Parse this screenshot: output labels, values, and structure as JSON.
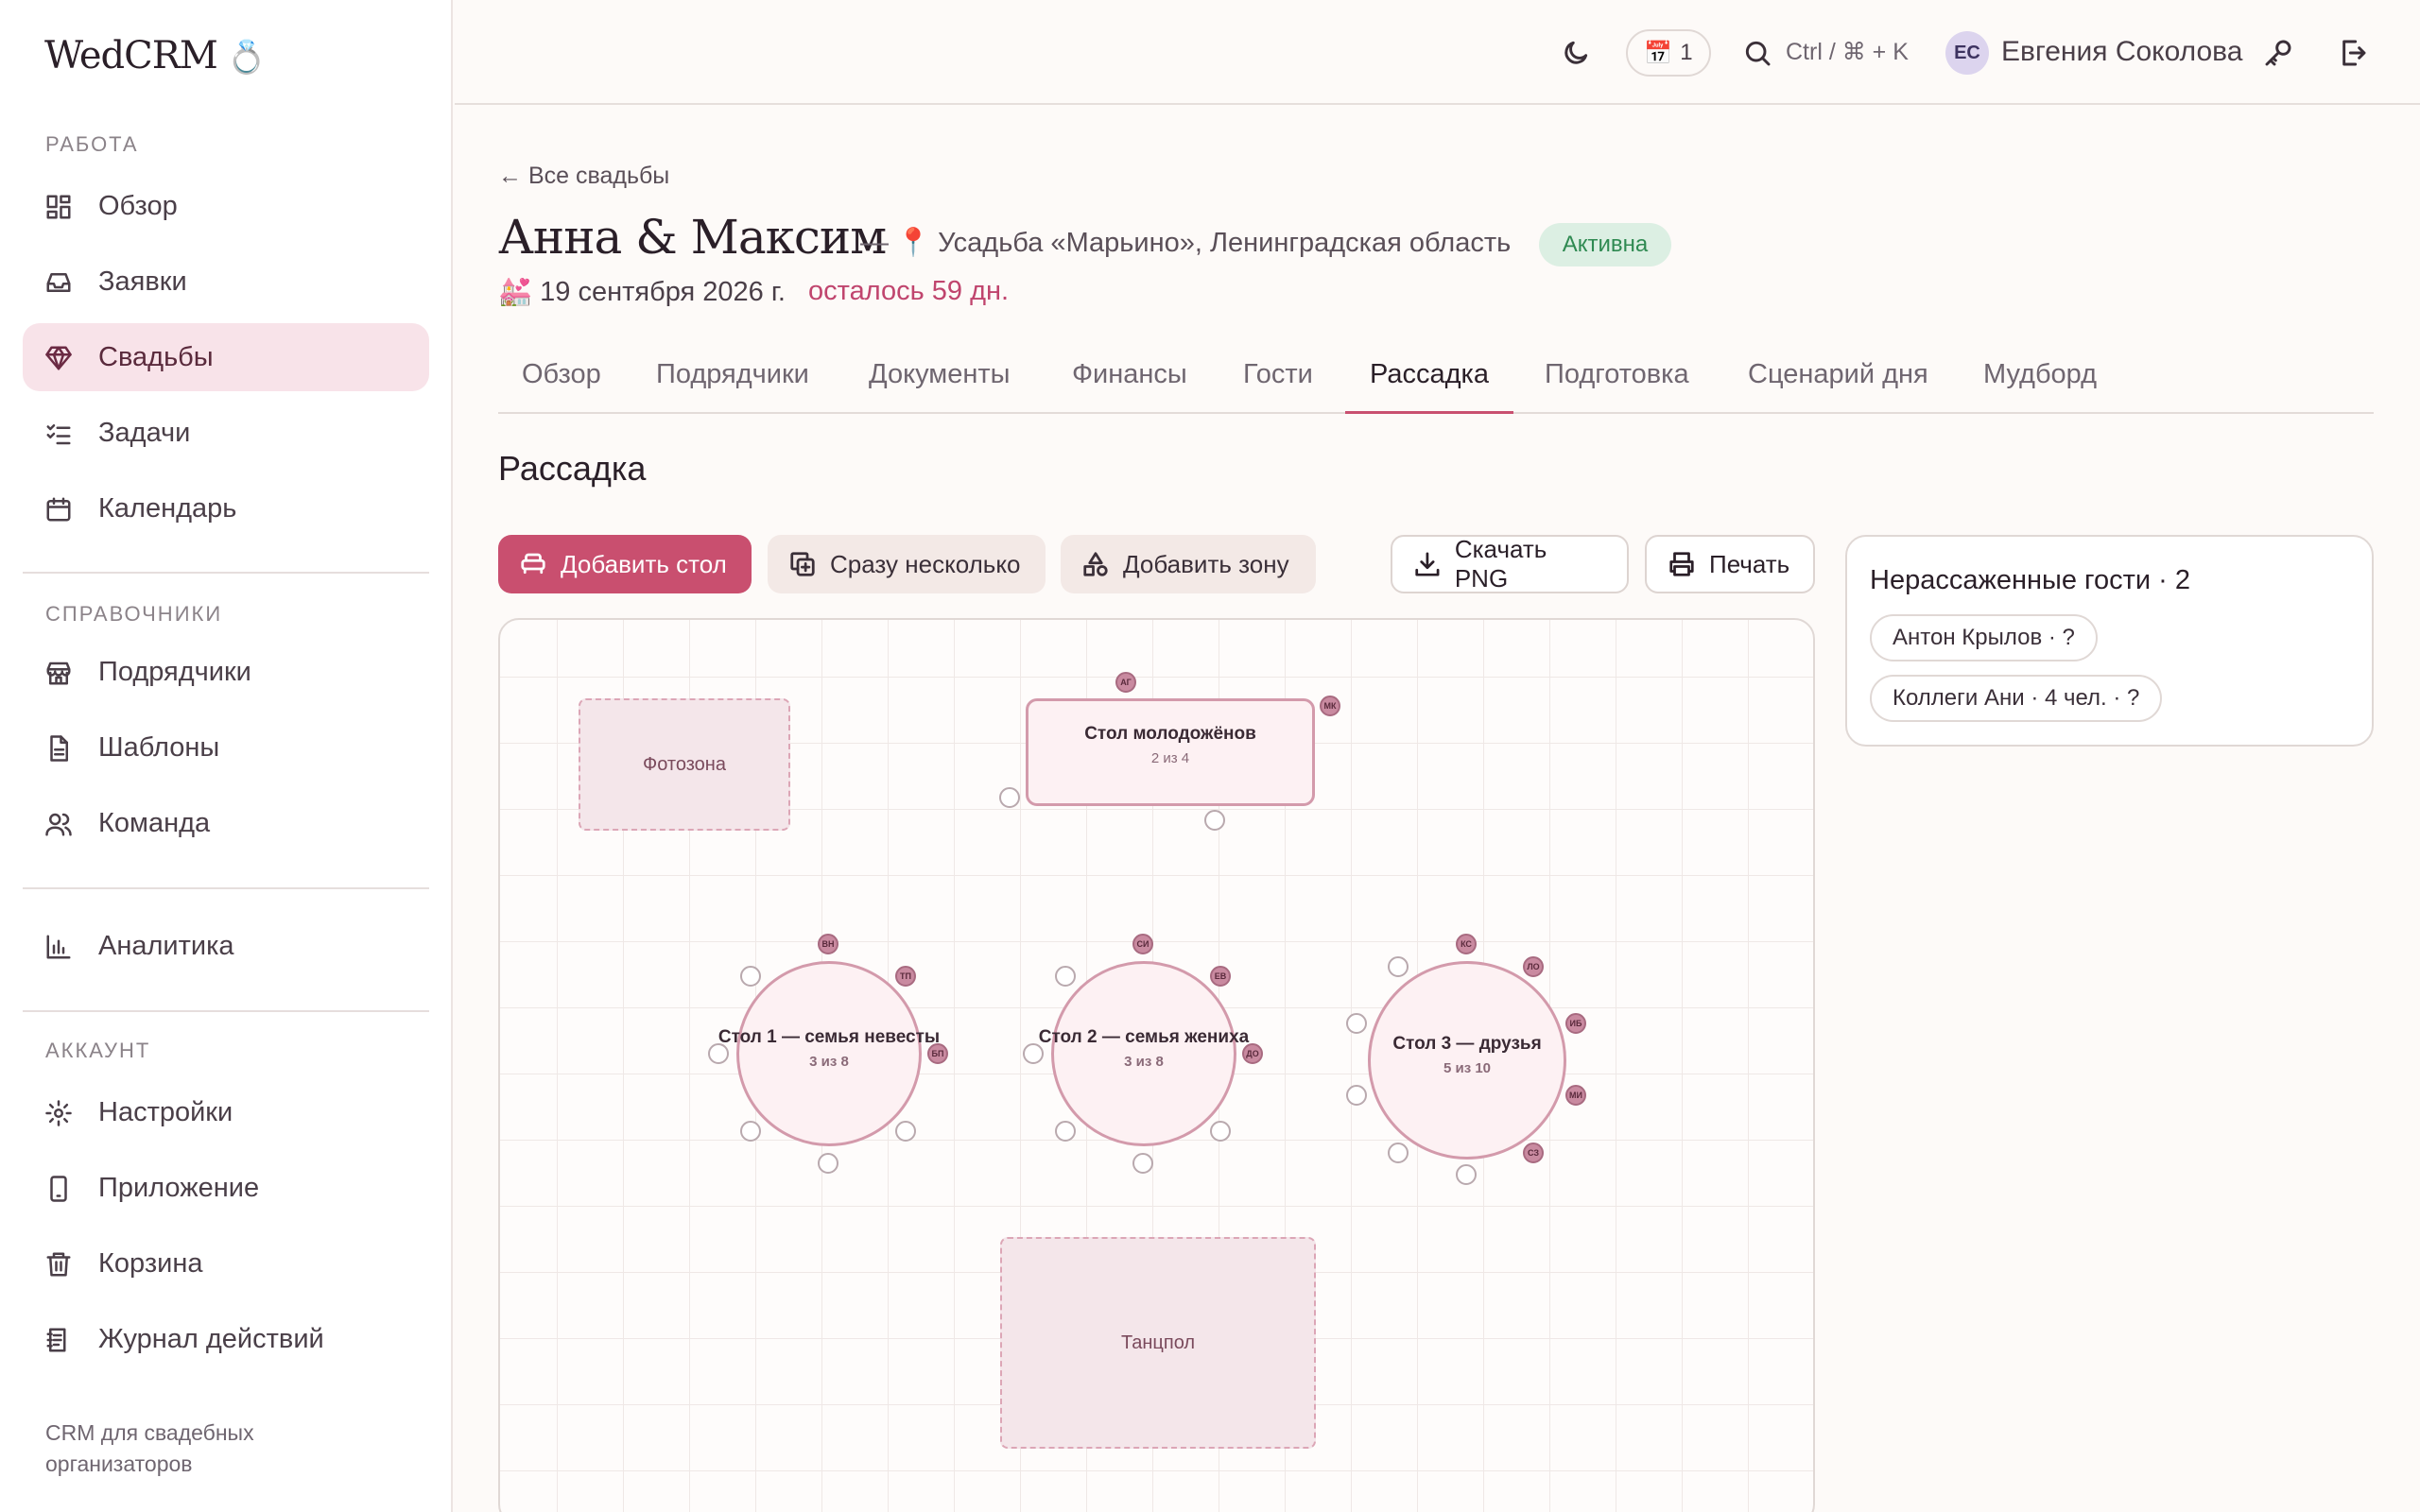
{
  "app": {
    "name": "WedCRM"
  },
  "sidebar": {
    "sections": {
      "work": "РАБОТА",
      "refs": "СПРАВОЧНИКИ",
      "account": "АККАУНТ"
    },
    "items": [
      {
        "label": "Обзор",
        "icon": "dashboard-icon"
      },
      {
        "label": "Заявки",
        "icon": "inbox-icon"
      },
      {
        "label": "Свадьбы",
        "icon": "diamond-icon"
      },
      {
        "label": "Задачи",
        "icon": "checklist-icon"
      },
      {
        "label": "Календарь",
        "icon": "calendar-icon"
      },
      {
        "label": "Подрядчики",
        "icon": "store-icon"
      },
      {
        "label": "Шаблоны",
        "icon": "document-icon"
      },
      {
        "label": "Команда",
        "icon": "users-icon"
      },
      {
        "label": "Аналитика",
        "icon": "chart-icon"
      },
      {
        "label": "Настройки",
        "icon": "gear-icon"
      },
      {
        "label": "Приложение",
        "icon": "phone-icon"
      },
      {
        "label": "Корзина",
        "icon": "trash-icon"
      },
      {
        "label": "Журнал действий",
        "icon": "log-icon"
      }
    ],
    "active": "Свадьбы",
    "footer": "CRM для свадебных организаторов"
  },
  "topbar": {
    "notifications_count": "1",
    "search_shortcut": "Ctrl / ⌘ + K",
    "user_initials": "ЕС",
    "user_name": "Евгения Соколова"
  },
  "page": {
    "back_link": "← Все свадьбы",
    "title": "Анна & Максим",
    "dash": "—",
    "venue": "📍 Усадьба «Марьино», Ленинградская область",
    "status": "Активна",
    "date": "💒 19 сентября 2026 г.",
    "remaining": "осталось 59 дн."
  },
  "tabs": [
    "Обзор",
    "Подрядчики",
    "Документы",
    "Финансы",
    "Гости",
    "Рассадка",
    "Подготовка",
    "Сценарий дня",
    "Мудборд"
  ],
  "active_tab": "Рассадка",
  "section_title": "Рассадка",
  "toolbar": {
    "add_table": "Добавить стол",
    "add_many": "Сразу несколько",
    "add_zone": "Добавить зону",
    "download_png": "Скачать PNG",
    "print": "Печать"
  },
  "plan": {
    "zones": {
      "photo": "Фотозона",
      "dance": "Танцпол"
    },
    "newlyweds": {
      "name": "Стол молодожёнов",
      "count": "2 из 4",
      "seats": [
        "АГ",
        "МК"
      ]
    },
    "table1": {
      "name": "Стол 1 — семья невесты",
      "count": "3 из 8",
      "seats": [
        "ВН",
        "ТП",
        "БП"
      ]
    },
    "table2": {
      "name": "Стол 2 — семья жениха",
      "count": "3 из 8",
      "seats": [
        "СИ",
        "ЕВ",
        "ДО"
      ]
    },
    "table3": {
      "name": "Стол 3 — друзья",
      "count": "5 из 10",
      "seats": [
        "КС",
        "ЛО",
        "ИБ",
        "МИ",
        "СЗ"
      ]
    }
  },
  "unseated": {
    "title": "Нерассаженные гости · 2",
    "guests": [
      "Антон Крылов · ?",
      "Коллеги Ани · 4 чел. · ?"
    ]
  },
  "colors": {
    "accent": "#c94f6f",
    "active_bg": "#f8e3e9",
    "status_bg": "#dcefe3",
    "status_fg": "#2f8a52"
  }
}
